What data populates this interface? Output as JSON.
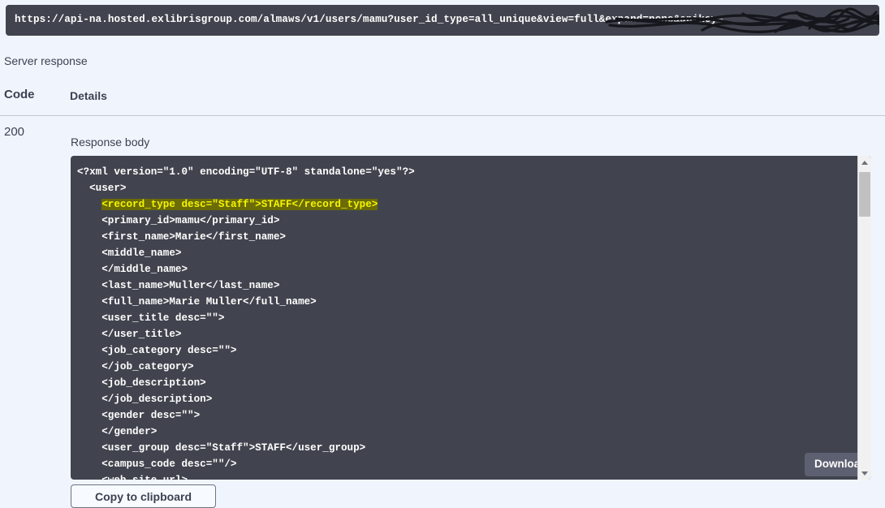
{
  "url_bar": {
    "url": "https://api-na.hosted.exlibrisgroup.com/almaws/v1/users/mamu?user_id_type=all_unique&view=full&expand=none&apikey=",
    "redacted_note": "apikey value scribbled out"
  },
  "panel": {
    "server_response_label": "Server response",
    "columns": {
      "code": "Code",
      "details": "Details"
    },
    "row": {
      "code": "200",
      "response_body_label": "Response body"
    }
  },
  "response_body": {
    "lines": [
      {
        "indent": 0,
        "text": "<?xml version=\"1.0\" encoding=\"UTF-8\" standalone=\"yes\"?>",
        "highlighted": false
      },
      {
        "indent": 1,
        "text": "<user>",
        "highlighted": false
      },
      {
        "indent": 2,
        "text": "<record_type desc=\"Staff\">STAFF</record_type>",
        "highlighted": true
      },
      {
        "indent": 2,
        "text": "<primary_id>mamu</primary_id>",
        "highlighted": false
      },
      {
        "indent": 2,
        "text": "<first_name>Marie</first_name>",
        "highlighted": false
      },
      {
        "indent": 2,
        "text": "<middle_name>",
        "highlighted": false
      },
      {
        "indent": 2,
        "text": "</middle_name>",
        "highlighted": false
      },
      {
        "indent": 2,
        "text": "<last_name>Muller</last_name>",
        "highlighted": false
      },
      {
        "indent": 2,
        "text": "<full_name>Marie Muller</full_name>",
        "highlighted": false
      },
      {
        "indent": 2,
        "text": "<user_title desc=\"\">",
        "highlighted": false
      },
      {
        "indent": 2,
        "text": "</user_title>",
        "highlighted": false
      },
      {
        "indent": 2,
        "text": "<job_category desc=\"\">",
        "highlighted": false
      },
      {
        "indent": 2,
        "text": "</job_category>",
        "highlighted": false
      },
      {
        "indent": 2,
        "text": "<job_description>",
        "highlighted": false
      },
      {
        "indent": 2,
        "text": "</job_description>",
        "highlighted": false
      },
      {
        "indent": 2,
        "text": "<gender desc=\"\">",
        "highlighted": false
      },
      {
        "indent": 2,
        "text": "</gender>",
        "highlighted": false
      },
      {
        "indent": 2,
        "text": "<user_group desc=\"Staff\">STAFF</user_group>",
        "highlighted": false
      },
      {
        "indent": 2,
        "text": "<campus_code desc=\"\"/>",
        "highlighted": false
      },
      {
        "indent": 2,
        "text": "<web_site_url>",
        "highlighted": false
      }
    ]
  },
  "buttons": {
    "download": "Download",
    "copy_to_clipboard": "Copy to clipboard"
  },
  "colors": {
    "page_background": "#f0f5fd",
    "code_background": "#41444e",
    "highlight_background": "#6b6b07",
    "highlight_text": "#f5f500",
    "text": "#3b4151"
  }
}
